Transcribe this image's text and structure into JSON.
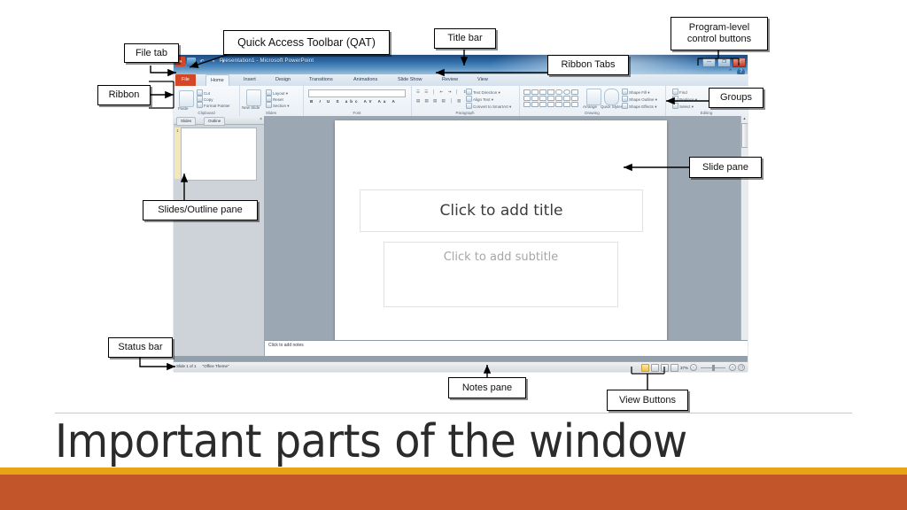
{
  "slide": {
    "title": "Important parts of the window",
    "accent_thin": "#E8A317",
    "accent_thick": "#C2562A"
  },
  "callouts": [
    {
      "id": "file-tab",
      "label": "File tab"
    },
    {
      "id": "qat",
      "label": "Quick Access Toolbar (QAT)"
    },
    {
      "id": "title-bar",
      "label": "Title bar"
    },
    {
      "id": "program-control",
      "label": "Program-level\ncontrol buttons"
    },
    {
      "id": "ribbon-tabs",
      "label": "Ribbon Tabs"
    },
    {
      "id": "ribbon",
      "label": "Ribbon"
    },
    {
      "id": "groups",
      "label": "Groups"
    },
    {
      "id": "slide-pane",
      "label": "Slide pane"
    },
    {
      "id": "slides-outline",
      "label": "Slides/Outline pane"
    },
    {
      "id": "status-bar",
      "label": "Status bar"
    },
    {
      "id": "notes-pane",
      "label": "Notes pane"
    },
    {
      "id": "view-buttons",
      "label": "View Buttons"
    }
  ],
  "powerpoint": {
    "window_title": "Presentation1 - Microsoft PowerPoint",
    "quick_access": {
      "office_glyph": "●",
      "save_icon": "save-icon",
      "undo_icon": "undo-icon",
      "redo_icon": "redo-icon",
      "customize_glyph": "▾"
    },
    "window_controls": {
      "minimize": "—",
      "restore": "❐",
      "close": "✕",
      "help": "?",
      "ribbon_minimize": "⌃"
    },
    "tabs": [
      {
        "label": "File",
        "active": false,
        "file": true
      },
      {
        "label": "Home",
        "active": true,
        "file": false
      },
      {
        "label": "Insert",
        "active": false,
        "file": false
      },
      {
        "label": "Design",
        "active": false,
        "file": false
      },
      {
        "label": "Transitions",
        "active": false,
        "file": false
      },
      {
        "label": "Animations",
        "active": false,
        "file": false
      },
      {
        "label": "Slide Show",
        "active": false,
        "file": false
      },
      {
        "label": "Review",
        "active": false,
        "file": false
      },
      {
        "label": "View",
        "active": false,
        "file": false
      }
    ],
    "ribbon_groups": [
      {
        "name": "Clipboard",
        "items": [
          "Paste",
          "Cut",
          "Copy",
          "Format Painter"
        ]
      },
      {
        "name": "Slides",
        "items": [
          "New Slide",
          "Layout",
          "Reset",
          "Section"
        ]
      },
      {
        "name": "Font",
        "items": [
          "B",
          "I",
          "U",
          "S",
          "abc",
          "AV",
          "Aa",
          "A"
        ]
      },
      {
        "name": "Paragraph",
        "items": [
          "Text Direction",
          "Align Text",
          "Convert to SmartArt"
        ]
      },
      {
        "name": "Drawing",
        "items": [
          "Arrange",
          "Quick Styles",
          "Shape Fill",
          "Shape Outline",
          "Shape Effects"
        ]
      },
      {
        "name": "Editing",
        "items": [
          "Find",
          "Replace",
          "Select"
        ]
      }
    ],
    "slides_pane": {
      "tabs": [
        "Slides",
        "Outline"
      ],
      "close_glyph": "×",
      "thumb_number": "1"
    },
    "slide": {
      "title_placeholder": "Click to add title",
      "subtitle_placeholder": "Click to add subtitle"
    },
    "notes_placeholder": "Click to add notes",
    "status_bar": {
      "slide_counter": "Slide 1 of 1",
      "theme": "\"Office Theme\"",
      "zoom_level": "37%",
      "zoom_out": "−",
      "zoom_in": "+",
      "fit_glyph": "❐",
      "view_buttons": [
        "Normal",
        "Slide Sorter",
        "Reading View",
        "Slide Show"
      ]
    },
    "scrollbar": {
      "up_glyph": "▲",
      "down_glyph": "▼"
    }
  }
}
